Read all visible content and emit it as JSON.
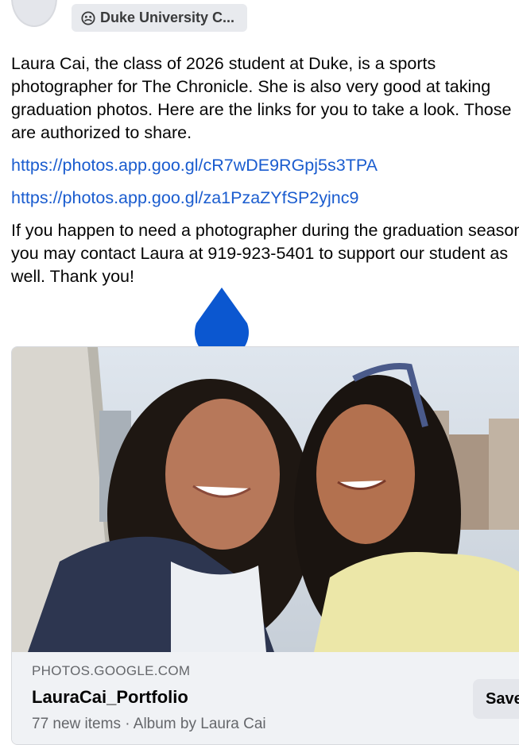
{
  "group": {
    "name": "Duke University C...",
    "icon": "group-icon"
  },
  "post": {
    "paragraph1": "Laura Cai, the class of 2026 student at Duke, is a sports photographer for The Chronicle. She is also very good at taking graduation photos. Here are the links for you to take a look. Those are authorized to share.",
    "link1": "https://photos.app.goo.gl/cR7wDE9RGpj5s3TPA",
    "link2": "https://photos.app.goo.gl/za1PzaZYfSP2yjnc9",
    "paragraph2": "If you happen to need a photographer during the graduation season, you may contact Laura at 919-923-5401 to support our student as well. Thank you!"
  },
  "link_card": {
    "domain": "PHOTOS.GOOGLE.COM",
    "title": "LauraCai_Portfolio",
    "subtitle": "77 new items · Album by Laura Cai",
    "save_label": "Save"
  },
  "colors": {
    "link": "#1a5ccf",
    "cursor": "#0b57d0"
  }
}
